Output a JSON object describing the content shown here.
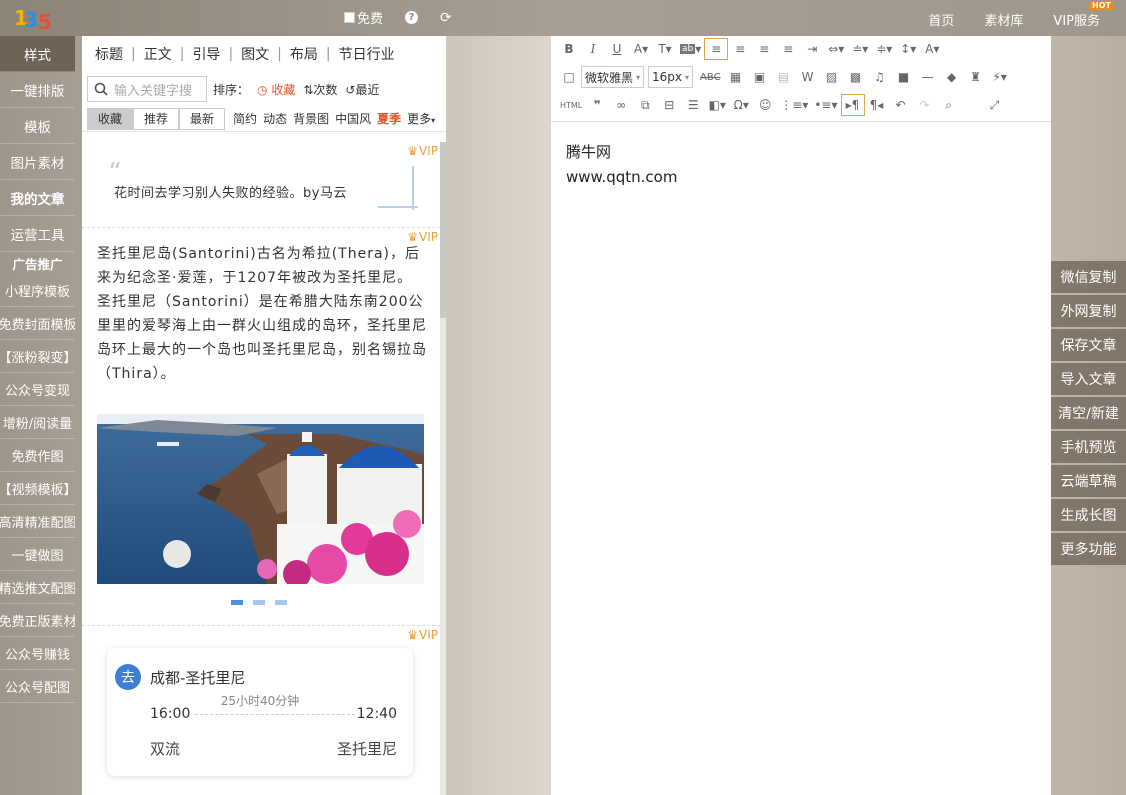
{
  "topbar": {
    "logo_text": "135",
    "free_label": "免费",
    "help_icon": "help-icon",
    "refresh_icon": "refresh-icon",
    "nav": {
      "home": "首页",
      "library": "素材库",
      "vip": "VIP服务",
      "hot": "HOT"
    }
  },
  "leftnav": {
    "items_top": [
      "样式",
      "一键排版",
      "模板",
      "图片素材",
      "我的文章",
      "运营工具"
    ],
    "ad_header": "广告推广",
    "items_ad": [
      "小程序模板",
      "免费封面模板",
      "【涨粉裂变】",
      "公众号变现",
      "增粉/阅读量",
      "免费作图",
      "【视频模板】",
      "高清精准配图",
      "一键做图",
      "精选推文配图",
      "免费正版素材",
      "公众号赚钱",
      "公众号配图"
    ]
  },
  "panel": {
    "tabs": [
      "标题",
      "正文",
      "引导",
      "图文",
      "布局",
      "节日行业"
    ],
    "search_placeholder": "输入关键字搜",
    "sort_label": "排序：",
    "sort_options": [
      "收藏",
      "次数",
      "最近"
    ],
    "filter_buttons": [
      "收藏",
      "推荐",
      "最新"
    ],
    "filter_links": [
      "简约",
      "动态",
      "背景图",
      "中国风",
      "夏季",
      "更多"
    ],
    "vip_label": "VIP",
    "card1_quote": "花时间去学习别人失败的经验。by马云",
    "card2_text": "圣托里尼岛(Santorini)古名为希拉(Thera)，后来为纪念圣·爱莲，于1207年被改为圣托里尼。圣托里尼（Santorini）是在希腊大陆东南200公里里的爱琴海上由一群火山组成的岛环，圣托里尼岛环上最大的一个岛也叫圣托里尼岛，别名锡拉岛（Thira）。",
    "flight": {
      "go_label": "去",
      "route": "成都-圣托里尼",
      "duration": "25小时40分钟",
      "depart_time": "16:00",
      "arrive_time": "12:40",
      "depart_city": "双流",
      "arrive_city": "圣托里尼"
    }
  },
  "editor": {
    "font_family": "微软雅黑",
    "font_size": "16px",
    "content_lines": [
      "腾牛网",
      "www.qqtn.com"
    ]
  },
  "actions": [
    "微信复制",
    "外网复制",
    "保存文章",
    "导入文章",
    "清空/新建",
    "手机预览",
    "云端草稿",
    "生成长图",
    "更多功能"
  ]
}
